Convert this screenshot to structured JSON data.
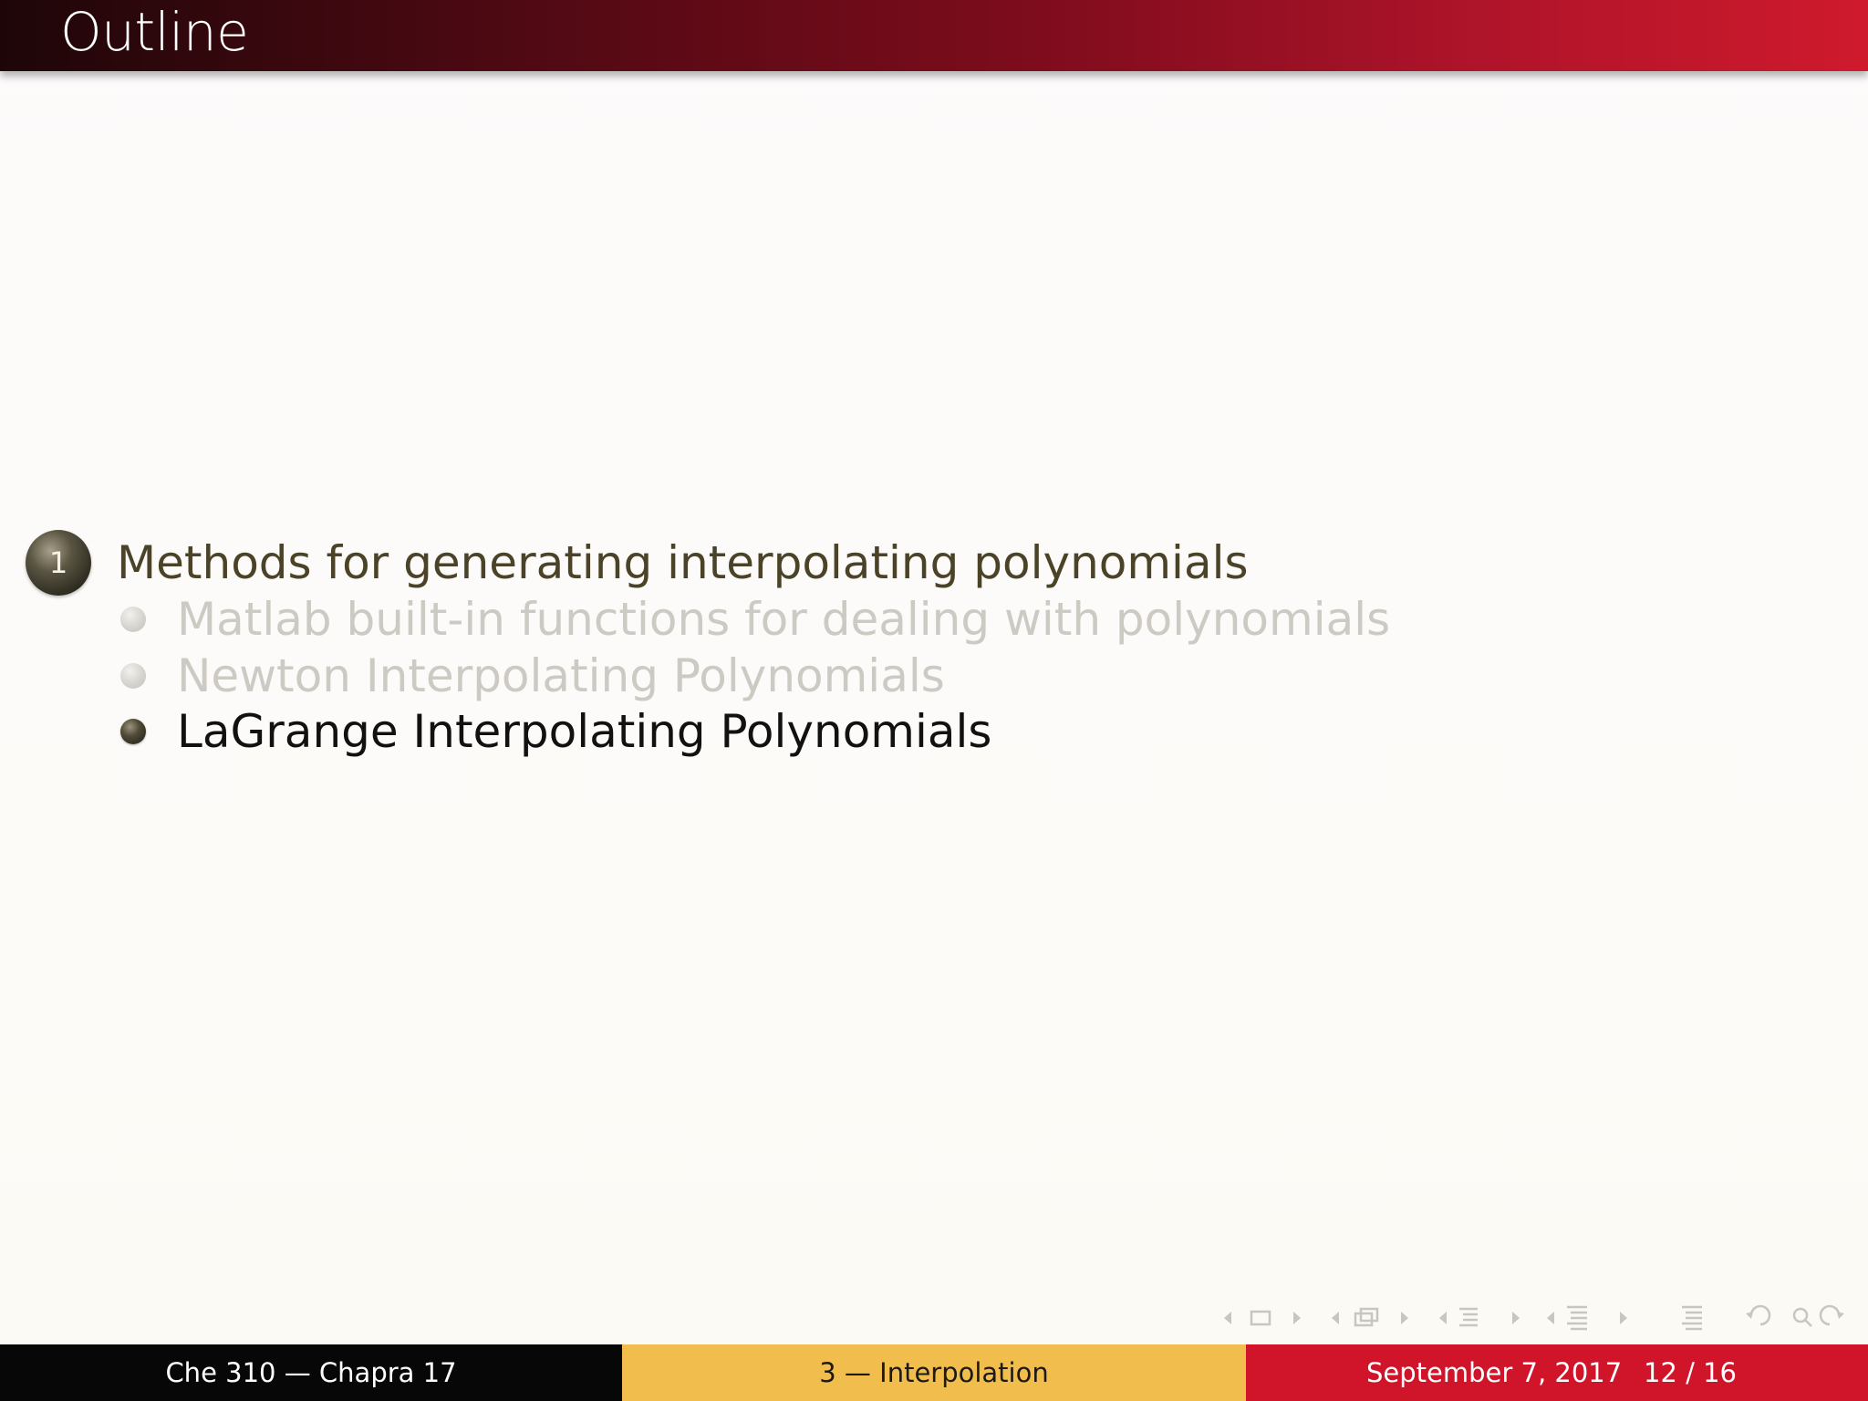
{
  "slide": {
    "title": "Outline"
  },
  "outline": {
    "section": {
      "number": "1",
      "label": "Methods for generating interpolating polynomials"
    },
    "subsections": [
      {
        "label": "Matlab built-in functions for dealing with polynomials",
        "state": "dimmed"
      },
      {
        "label": "Newton Interpolating Polynomials",
        "state": "dimmed"
      },
      {
        "label": "LaGrange Interpolating Polynomials",
        "state": "current"
      }
    ]
  },
  "navigation": {
    "icons": [
      "arrow-left-icon",
      "frame-icon",
      "arrow-right-icon",
      "arrow-left-icon",
      "subsection-icon",
      "arrow-right-icon",
      "arrow-left-icon",
      "section-icon",
      "arrow-right-icon",
      "arrow-left-icon",
      "presentation-icon",
      "arrow-right-icon",
      "toc-icon",
      "back-icon",
      "search-icon",
      "forward-icon"
    ]
  },
  "footer": {
    "author": "Che 310 — Chapra 17",
    "section": "3 — Interpolation",
    "date": "September 7, 2017",
    "page": "12 / 16"
  },
  "colors": {
    "title_gradient_start": "#1e0608",
    "title_gradient_end": "#cf1a2c",
    "footer_left": "#070707",
    "footer_middle": "#f1be4e",
    "footer_right": "#d0152a",
    "section_text": "#4a4327",
    "dimmed_text": "#cdcac4"
  }
}
